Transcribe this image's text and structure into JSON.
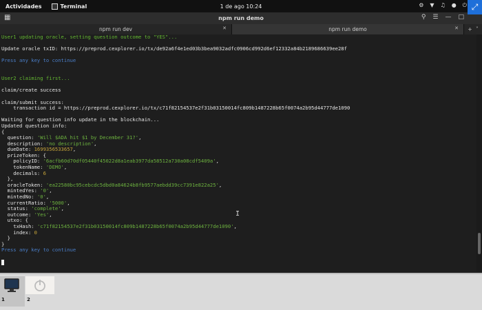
{
  "topbar": {
    "activities": "Actividades",
    "app_name": "Terminal",
    "clock": "1 de ago  10:24"
  },
  "window": {
    "title": "npm run demo"
  },
  "tabs": [
    {
      "label": "npm run dev",
      "active": false
    },
    {
      "label": "npm run demo",
      "active": true
    }
  ],
  "terminal": {
    "lines": [
      {
        "style": "green",
        "text": "User1 updating oracle, setting question outcome to \"YES\"..."
      },
      {
        "style": "white",
        "text": ""
      },
      {
        "style": "white",
        "text": "Update oracle txID: https://preprod.cexplorer.io/tx/de92a6f4e1ed03b3bea9032adfc0906cd992d6ef12332a84b2189686639ee28f"
      },
      {
        "style": "white",
        "text": ""
      },
      {
        "style": "blue",
        "text": "Press any key to continue"
      },
      {
        "style": "white",
        "text": ""
      },
      {
        "style": "white",
        "text": ""
      },
      {
        "style": "green",
        "text": "User2 claiming first..."
      },
      {
        "style": "white",
        "text": ""
      },
      {
        "style": "white",
        "text": "claim/create success"
      },
      {
        "style": "white",
        "text": ""
      },
      {
        "style": "white",
        "text": "claim/submit success:"
      },
      {
        "style": "white",
        "text": "    transaction id = https://preprod.cexplorer.io/tx/c71f82154537e2f31b03150014fc809b1487228b65f0074a2b95d44777de1090"
      },
      {
        "style": "white",
        "text": ""
      },
      {
        "style": "white",
        "text": "Waiting for question info update in the blockchain..."
      },
      {
        "style": "white",
        "text": "Updated question info:"
      },
      {
        "style": "white",
        "text": "{"
      },
      {
        "style": "kv",
        "key": "  question: ",
        "val": "'Will $ADA hit $1 by December 31?'",
        "tail": ",",
        "valtype": "str"
      },
      {
        "style": "kv",
        "key": "  description: ",
        "val": "'no description'",
        "tail": ",",
        "valtype": "str"
      },
      {
        "style": "kv",
        "key": "  dueDate: ",
        "val": "1699356533657",
        "tail": ",",
        "valtype": "num"
      },
      {
        "style": "white",
        "text": "  prizeToken: {"
      },
      {
        "style": "kv",
        "key": "    policyID: ",
        "val": "'6acfb60d70df05440f45022d8a1eab3977da58512a730a08cdf5409a'",
        "tail": ",",
        "valtype": "str"
      },
      {
        "style": "kv",
        "key": "    tokenName: ",
        "val": "'DEMO'",
        "tail": ",",
        "valtype": "str"
      },
      {
        "style": "kv",
        "key": "    decimals: ",
        "val": "6",
        "tail": "",
        "valtype": "num"
      },
      {
        "style": "white",
        "text": "  },"
      },
      {
        "style": "kv",
        "key": "  oracleToken: ",
        "val": "'ea22580bc95cebcdc5dbd0a84624b8fb9577aebdd39cc7391e822a25'",
        "tail": ",",
        "valtype": "str"
      },
      {
        "style": "kv",
        "key": "  mintedYes: ",
        "val": "'0'",
        "tail": ",",
        "valtype": "str"
      },
      {
        "style": "kv",
        "key": "  mintedNo: ",
        "val": "'0'",
        "tail": ",",
        "valtype": "str"
      },
      {
        "style": "kv",
        "key": "  currentRatio: ",
        "val": "'5000'",
        "tail": ",",
        "valtype": "str"
      },
      {
        "style": "kv",
        "key": "  status: ",
        "val": "'complete'",
        "tail": ",",
        "valtype": "str"
      },
      {
        "style": "kv",
        "key": "  outcome: ",
        "val": "'Yes'",
        "tail": ",",
        "valtype": "str"
      },
      {
        "style": "white",
        "text": "  utxo: {"
      },
      {
        "style": "kv",
        "key": "    txHash: ",
        "val": "'c71f82154537e2f31b03150014fc809b1487228b65f0074a2b95d44777de1090'",
        "tail": ",",
        "valtype": "str"
      },
      {
        "style": "kv",
        "key": "    index: ",
        "val": "0",
        "tail": "",
        "valtype": "num"
      },
      {
        "style": "white",
        "text": "  }"
      },
      {
        "style": "white",
        "text": "}"
      },
      {
        "style": "blue",
        "text": "Press any key to continue"
      },
      {
        "style": "white",
        "text": ""
      },
      {
        "style": "cursor",
        "text": ""
      }
    ],
    "scroll_position": 0.92,
    "scroll_visible_fraction": 0.09
  },
  "workspaces": [
    {
      "number": "1",
      "active": true
    },
    {
      "number": "2",
      "active": false
    }
  ],
  "icons": {
    "terminal": "terminal-icon",
    "monitor": "monitor-icon",
    "power": "power-icon"
  }
}
